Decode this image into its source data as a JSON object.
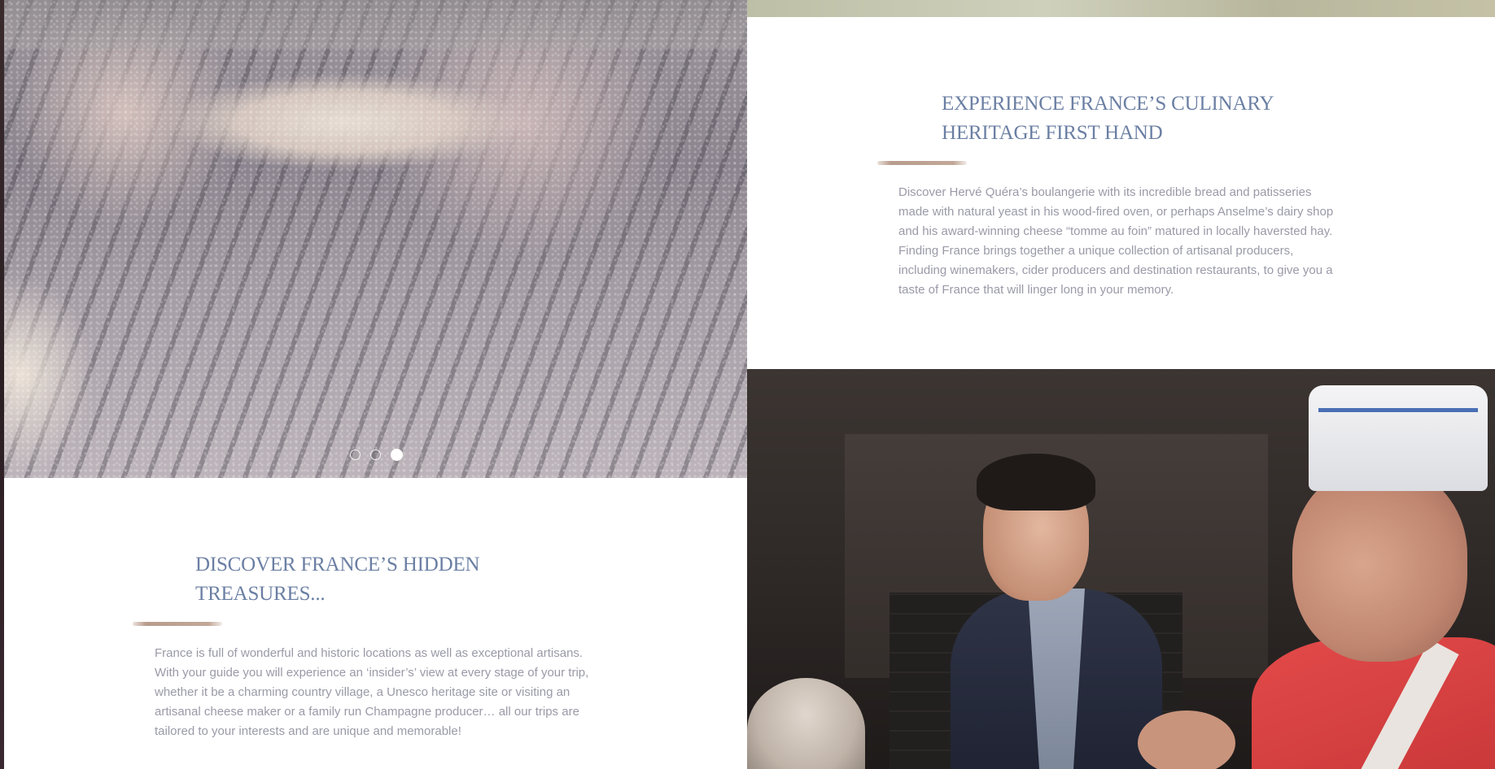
{
  "slider": {
    "image_icon": "dough-kneading-photo",
    "dots": [
      {
        "label": "Slide 1",
        "active": false
      },
      {
        "label": "Slide 2",
        "active": false
      },
      {
        "label": "Slide 3",
        "active": true
      }
    ]
  },
  "culinary": {
    "title": "EXPERIENCE FRANCE’S CULINARY\nHERITAGE FIRST HAND",
    "body": "Discover Hervé Quéra’s boulangerie with its incredible bread and patisseries made with natural yeast in his wood-fired oven, or perhaps Anselme’s dairy shop and his award-winning cheese “tomme au foin” matured in  locally haversted hay. Finding France brings together a unique collection of artisanal producers, including winemakers, cider producers and destination restaurants, to give you a taste of France that will linger long in your memory."
  },
  "treasures": {
    "title": "DISCOVER FRANCE’S HIDDEN\nTREASURES...",
    "body": "France is full of wonderful and historic locations as well as exceptional artisans. With your guide you will experience an ‘insider’s’ view at every stage of your trip, whether it be a charming country village, a Unesco heritage site or  visiting an artisanal cheese maker or a family run Champagne producer… all our trips are tailored to your interests and are unique and memorable!"
  },
  "photo": {
    "image_icon": "bakers-chef-photo"
  },
  "colors": {
    "heading": "#6b7fa3",
    "body_text": "#9a9aa8",
    "swash": "#b89c8c"
  }
}
